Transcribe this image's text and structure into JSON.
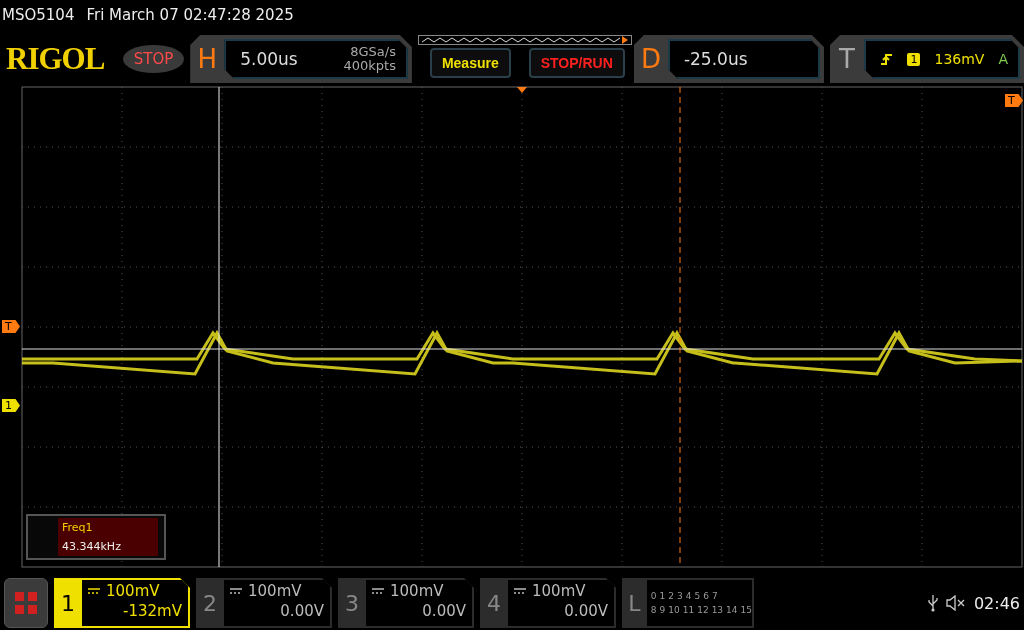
{
  "status_line": {
    "model": "MSO5104",
    "datetime": "Fri March 07 02:47:28 2025"
  },
  "header": {
    "logo": "RIGOL",
    "run_state": "STOP",
    "horizontal": {
      "label": "H",
      "timebase": "5.00us",
      "sample_rate": "8GSa/s",
      "memory_depth": "400kpts"
    },
    "measure_button": "Measure",
    "stop_run_button": "STOP/RUN",
    "delay": {
      "label": "D",
      "value": "-25.0us"
    },
    "trigger": {
      "label": "T",
      "source": "1",
      "level": "136mV",
      "mode": "A"
    }
  },
  "display": {
    "trigger_level_marker": "T",
    "channel_marker": "1",
    "trigger_position_marker": "T",
    "measurement": {
      "name": "Freq1",
      "value": "43.344kHz"
    }
  },
  "channels": [
    {
      "number": "1",
      "scale": "100mV",
      "offset": "-132mV",
      "selected": true
    },
    {
      "number": "2",
      "scale": "100mV",
      "offset": "0.00V",
      "selected": false
    },
    {
      "number": "3",
      "scale": "100mV",
      "offset": "0.00V",
      "selected": false
    },
    {
      "number": "4",
      "scale": "100mV",
      "offset": "0.00V",
      "selected": false
    }
  ],
  "logic": {
    "label": "L",
    "row_1": [
      "0",
      "1",
      "2",
      "3",
      "4",
      "5",
      "6",
      "7"
    ],
    "row_2": [
      "8",
      "9",
      "10",
      "11",
      "12",
      "13",
      "14",
      "15"
    ]
  },
  "status_icons": {
    "time": "02:46"
  }
}
